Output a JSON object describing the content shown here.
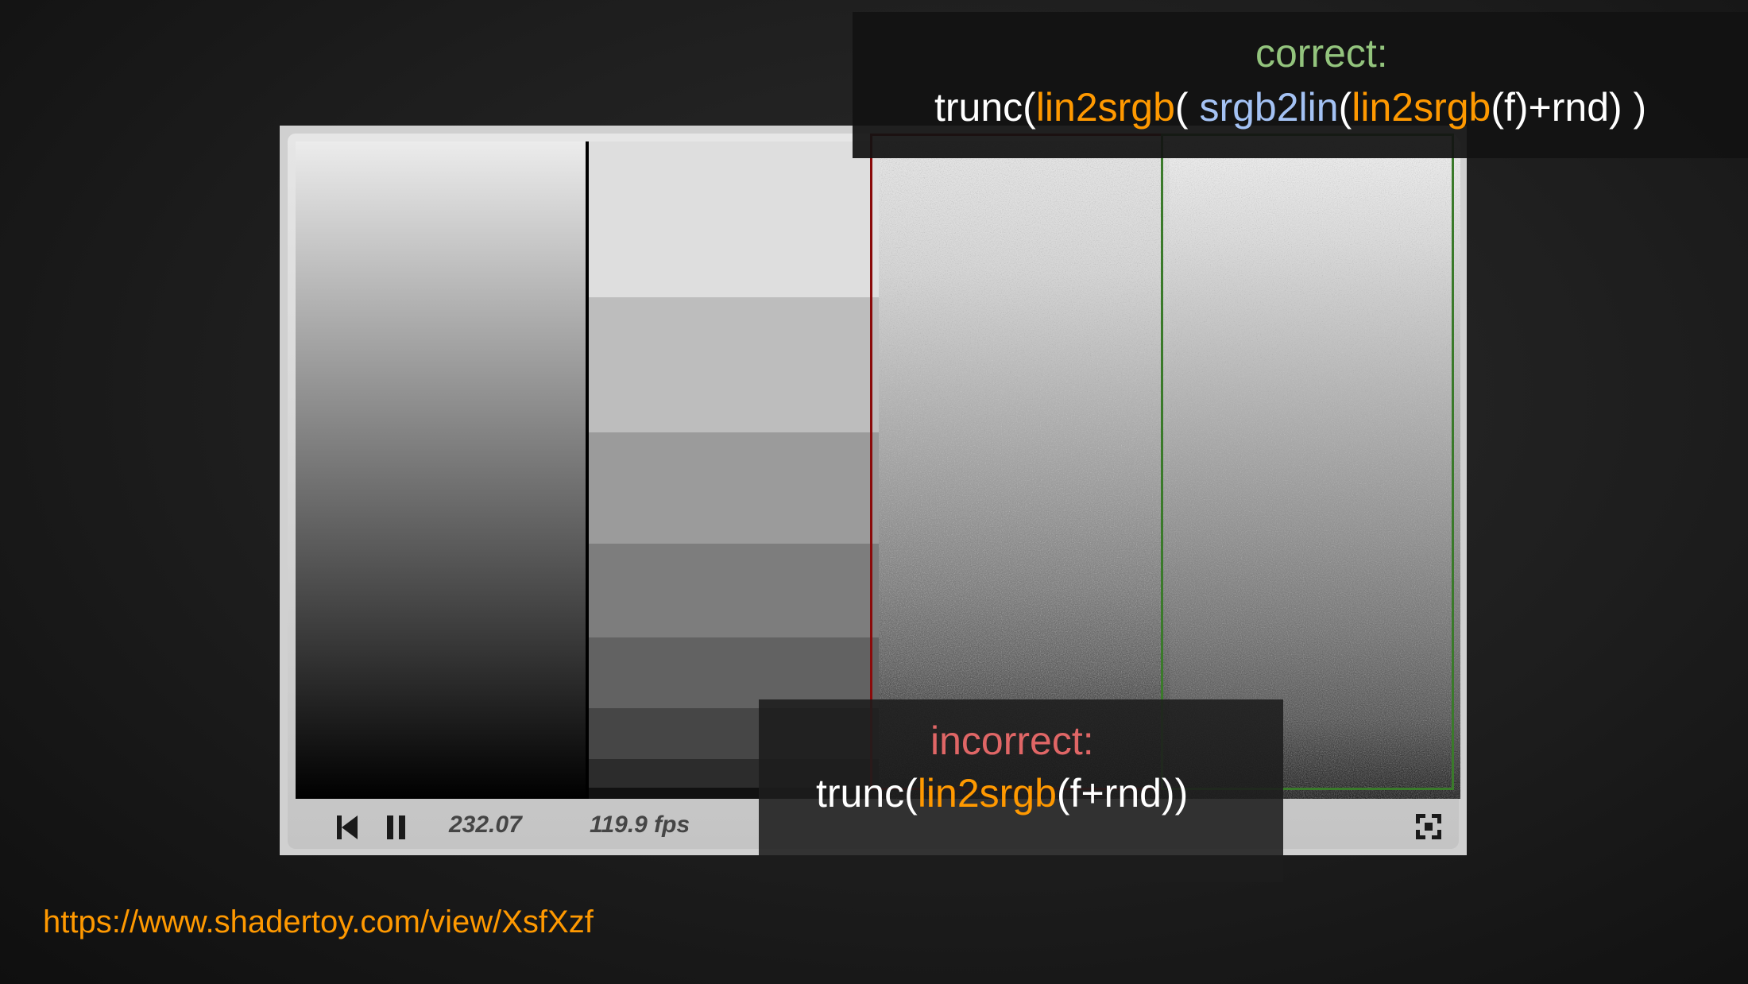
{
  "player": {
    "time": "232.07",
    "fps": "119.9 fps",
    "icons": {
      "rewind": "skip-to-start-icon",
      "pause": "pause-icon",
      "fullscreen": "fullscreen-icon"
    },
    "steps": [
      {
        "color": "#dedede"
      },
      {
        "color": "#bdbdbd"
      },
      {
        "color": "#9b9b9b"
      },
      {
        "color": "#7d7d7d"
      },
      {
        "color": "#626262"
      },
      {
        "color": "#464646"
      },
      {
        "color": "#2c2c2c"
      },
      {
        "color": "#111111"
      }
    ]
  },
  "captions": {
    "correct": {
      "heading": "correct:",
      "color": "#93c47d",
      "formula": {
        "p1": "trunc(",
        "p2": "lin2srgb",
        "p3": "( ",
        "p4": "srgb2lin",
        "p5": "(",
        "p6": "lin2srgb",
        "p7": "(f)+rnd) )"
      }
    },
    "incorrect": {
      "heading": "incorrect:",
      "color": "#e06666",
      "formula": {
        "p1": "trunc(",
        "p2": "lin2srgb",
        "p3": "(f+rnd))"
      }
    }
  },
  "link": "https://www.shadertoy.com/view/XsfXzf",
  "colors": {
    "accent_orange": "#ff9900",
    "accent_blue": "#a4c2f4",
    "incorrect_border": "#8a0a0a",
    "correct_border": "#3a7a2a"
  }
}
